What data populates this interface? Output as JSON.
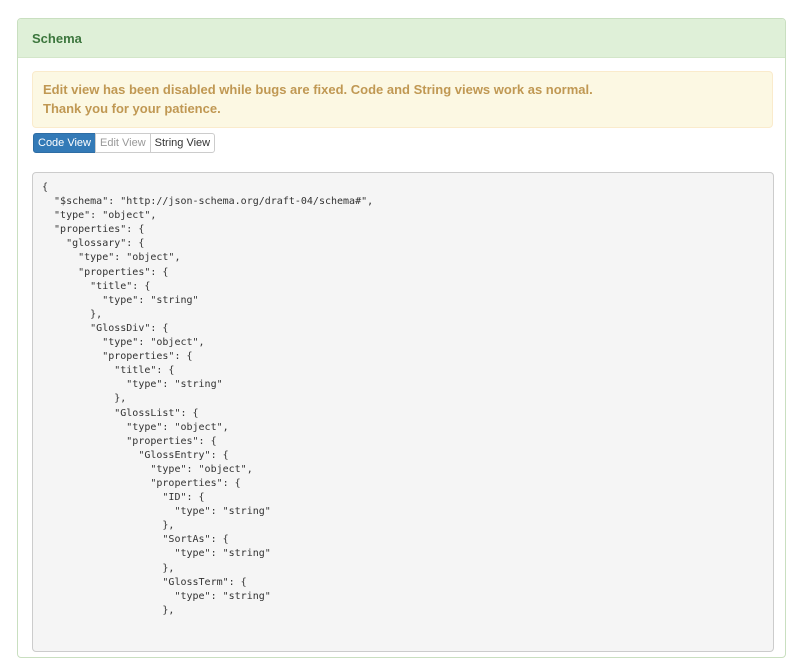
{
  "panel": {
    "title": "Schema"
  },
  "alert": {
    "line1": "Edit view has been disabled while bugs are fixed. Code and String views work as normal.",
    "line2": "Thank you for your patience."
  },
  "view_tabs": {
    "code": "Code View",
    "edit": "Edit View",
    "string": "String View",
    "active": "Code View"
  },
  "code_lines": [
    "{",
    "  \"$schema\": \"http://json-schema.org/draft-04/schema#\",",
    "  \"type\": \"object\",",
    "  \"properties\": {",
    "    \"glossary\": {",
    "      \"type\": \"object\",",
    "      \"properties\": {",
    "        \"title\": {",
    "          \"type\": \"string\"",
    "        },",
    "        \"GlossDiv\": {",
    "          \"type\": \"object\",",
    "          \"properties\": {",
    "            \"title\": {",
    "              \"type\": \"string\"",
    "            },",
    "            \"GlossList\": {",
    "              \"type\": \"object\",",
    "              \"properties\": {",
    "                \"GlossEntry\": {",
    "                  \"type\": \"object\",",
    "                  \"properties\": {",
    "                    \"ID\": {",
    "                      \"type\": \"string\"",
    "                    },",
    "                    \"SortAs\": {",
    "                      \"type\": \"string\"",
    "                    },",
    "                    \"GlossTerm\": {",
    "                      \"type\": \"string\"",
    "                    },"
  ]
}
